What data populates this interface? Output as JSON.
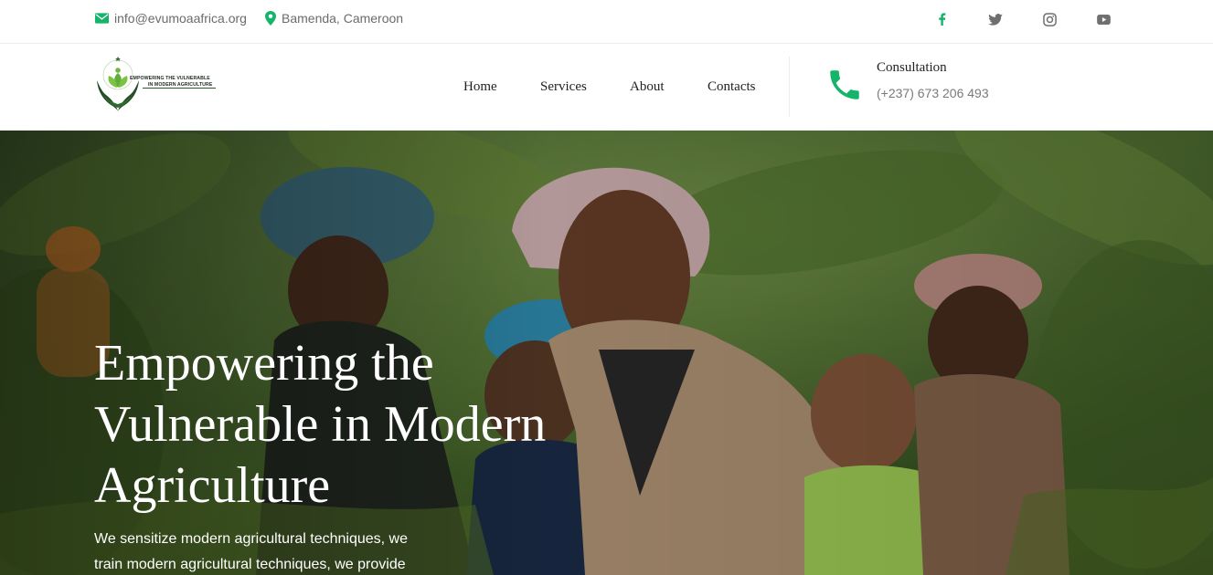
{
  "topbar": {
    "email": "info@evumoaafrica.org",
    "location": "Bamenda, Cameroon",
    "social": [
      "facebook-icon",
      "twitter-icon",
      "instagram-icon",
      "youtube-icon"
    ]
  },
  "logo": {
    "tagline_line1": "EMPOWERING THE VULNERABLE",
    "tagline_line2": "IN MODERN AGRICULTURE"
  },
  "nav": {
    "items": [
      "Home",
      "Services",
      "About",
      "Contacts"
    ]
  },
  "consultation": {
    "title": "Consultation",
    "phone": "(+237) 673 206 493"
  },
  "hero": {
    "title": "Empowering the Vulnerable in Modern Agriculture",
    "text": "We sensitize modern agricultural techniques, we train modern agricultural techniques, we provide"
  },
  "colors": {
    "accent": "#14b56a",
    "icon_gray": "#6f6f6f",
    "logo_green": "#2e6b2f"
  }
}
